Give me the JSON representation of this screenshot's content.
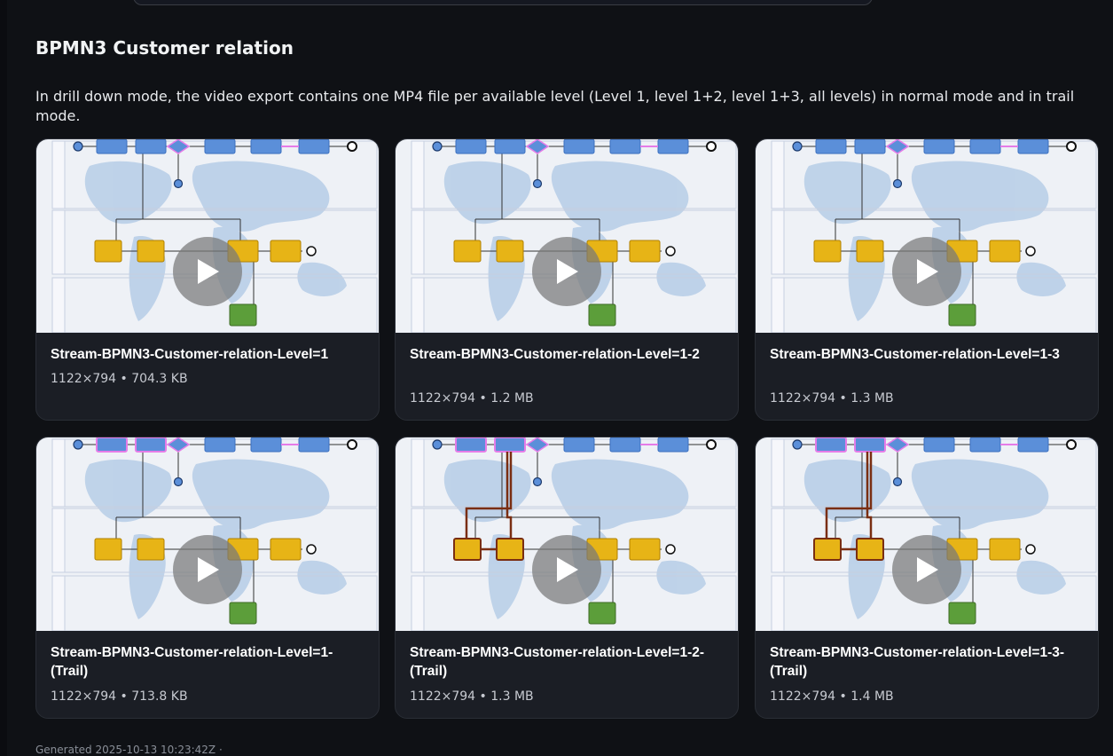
{
  "section": {
    "title": "BPMN3 Customer relation",
    "description": "In drill down mode, the video export contains one MP4 file per available level (Level 1, level 1+2, level 1+3, all levels) in normal mode and in trail mode."
  },
  "videos": [
    {
      "title": "Stream-BPMN3-Customer-relation-Level=1",
      "meta": "1122×794 • 704.3 KB",
      "trail": false,
      "highlight": "level1"
    },
    {
      "title": "Stream-BPMN3-Customer-relation-Level=1-2",
      "meta": "1122×794 • 1.2 MB",
      "trail": false,
      "highlight": "level1"
    },
    {
      "title": "Stream-BPMN3-Customer-relation-Level=1-3",
      "meta": "1122×794 • 1.3 MB",
      "trail": false,
      "highlight": "level1"
    },
    {
      "title": "Stream-BPMN3-Customer-relation-Level=1-(Trail)",
      "meta": "1122×794 • 713.8 KB",
      "trail": true,
      "highlight": "level1"
    },
    {
      "title": "Stream-BPMN3-Customer-relation-Level=1-2-(Trail)",
      "meta": "1122×794 • 1.3 MB",
      "trail": true,
      "highlight": "level2"
    },
    {
      "title": "Stream-BPMN3-Customer-relation-Level=1-3-(Trail)",
      "meta": "1122×794 • 1.4 MB",
      "trail": true,
      "highlight": "level3"
    }
  ],
  "footer": {
    "generated": "Generated 2025-10-13 10:23:42Z ·"
  },
  "icons": {
    "play": "play-icon"
  },
  "colors": {
    "background": "#0f1115",
    "card": "#1b1e25",
    "task_blue": "#5b8fd9",
    "task_yellow": "#e7b416",
    "task_green": "#5c9e3a",
    "highlight_pink": "#e57ce8",
    "trail_brown": "#7a2e12"
  }
}
